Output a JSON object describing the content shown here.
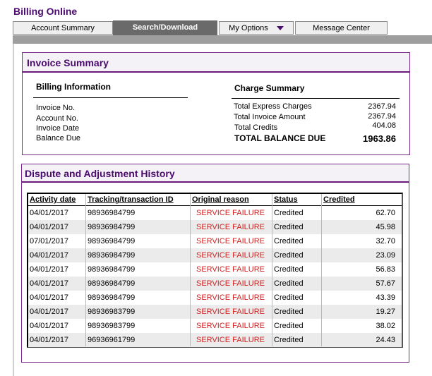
{
  "app": {
    "title": "Billing Online"
  },
  "tabs": [
    {
      "label": "Account Summary"
    },
    {
      "label": "Search/Download"
    },
    {
      "label": "My Options"
    },
    {
      "label": "Message Center"
    }
  ],
  "invoice_summary": {
    "title": "Invoice Summary",
    "billing_info": {
      "heading": "Billing Information",
      "labels": [
        "Invoice No.",
        "Account No.",
        "Invoice Date",
        "Balance Due"
      ]
    },
    "charge_summary": {
      "heading": "Charge Summary",
      "rows": [
        {
          "label": "Total Express Charges",
          "value": "2367.94"
        },
        {
          "label": "Total Invoice Amount",
          "value": "2367.94"
        },
        {
          "label": "Total Credits",
          "value": "404.08"
        }
      ],
      "total": {
        "label": "TOTAL BALANCE DUE",
        "value": "1963.86"
      }
    }
  },
  "dispute_history": {
    "title": "Dispute and Adjustment History",
    "columns": [
      "Activity date",
      "Tracking/transaction ID",
      "Original reason",
      "Status",
      "Credited"
    ],
    "rows": [
      {
        "date": "04/01/2017",
        "id": "98936984799",
        "reason": "SERVICE FAILURE",
        "status": "Credited",
        "credited": "62.70"
      },
      {
        "date": "04/01/2017",
        "id": "98936984799",
        "reason": "SERVICE FAILURE",
        "status": "Credited",
        "credited": "45.98"
      },
      {
        "date": "07/01/2017",
        "id": "98936984799",
        "reason": "SERVICE FAILURE",
        "status": "Credited",
        "credited": "32.70"
      },
      {
        "date": "04/01/2017",
        "id": "98936984799",
        "reason": "SERVICE FAILURE",
        "status": "Credited",
        "credited": "23.09"
      },
      {
        "date": "04/01/2017",
        "id": "98936984799",
        "reason": "SERVICE FAILURE",
        "status": "Credited",
        "credited": "56.83"
      },
      {
        "date": "04/01/2017",
        "id": "98936984799",
        "reason": "SERVICE FAILURE",
        "status": "Credited",
        "credited": "57.67"
      },
      {
        "date": "04/01/2017",
        "id": "98936984799",
        "reason": "SERVICE FAILURE",
        "status": "Credited",
        "credited": "43.39"
      },
      {
        "date": "04/01/2017",
        "id": "98936983799",
        "reason": "SERVICE FAILURE",
        "status": "Credited",
        "credited": "19.27"
      },
      {
        "date": "04/01/2017",
        "id": "98936983799",
        "reason": "SERVICE FAILURE",
        "status": "Credited",
        "credited": "38.02"
      },
      {
        "date": "04/01/2017",
        "id": "96936961799",
        "reason": "SERVICE FAILURE",
        "status": "Credited",
        "credited": "24.43"
      }
    ]
  },
  "colors": {
    "brand": "#4b0a6e",
    "reason": "#d42020",
    "active_tab": "#6a6a6a"
  },
  "icons": {
    "my_options_dropdown": "caret-down-icon"
  }
}
